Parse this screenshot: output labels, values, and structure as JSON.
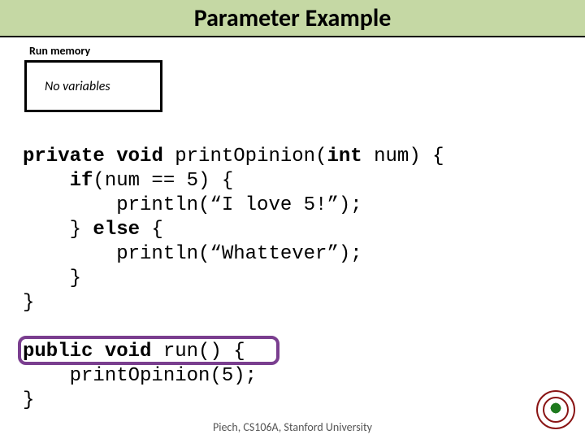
{
  "title": "Parameter Example",
  "memory": {
    "label": "Run memory",
    "content": "No variables"
  },
  "code1": {
    "l1a": "private",
    "l1b": " ",
    "l1c": "void",
    "l1d": " printOpinion(",
    "l1e": "int",
    "l1f": " num) {",
    "l2a": "    ",
    "l2b": "if",
    "l2c": "(num == 5) {",
    "l3": "        println(“I love 5!”);",
    "l4a": "    } ",
    "l4b": "else",
    "l4c": " {",
    "l5": "        println(“Whattever”);",
    "l6": "    }",
    "l7": "}"
  },
  "code2": {
    "l1a": "public",
    "l1b": " ",
    "l1c": "void",
    "l1d": " run() {",
    "l2": "    printOpinion(5);",
    "l3": "}"
  },
  "footer": "Piech, CS106A, Stanford University"
}
